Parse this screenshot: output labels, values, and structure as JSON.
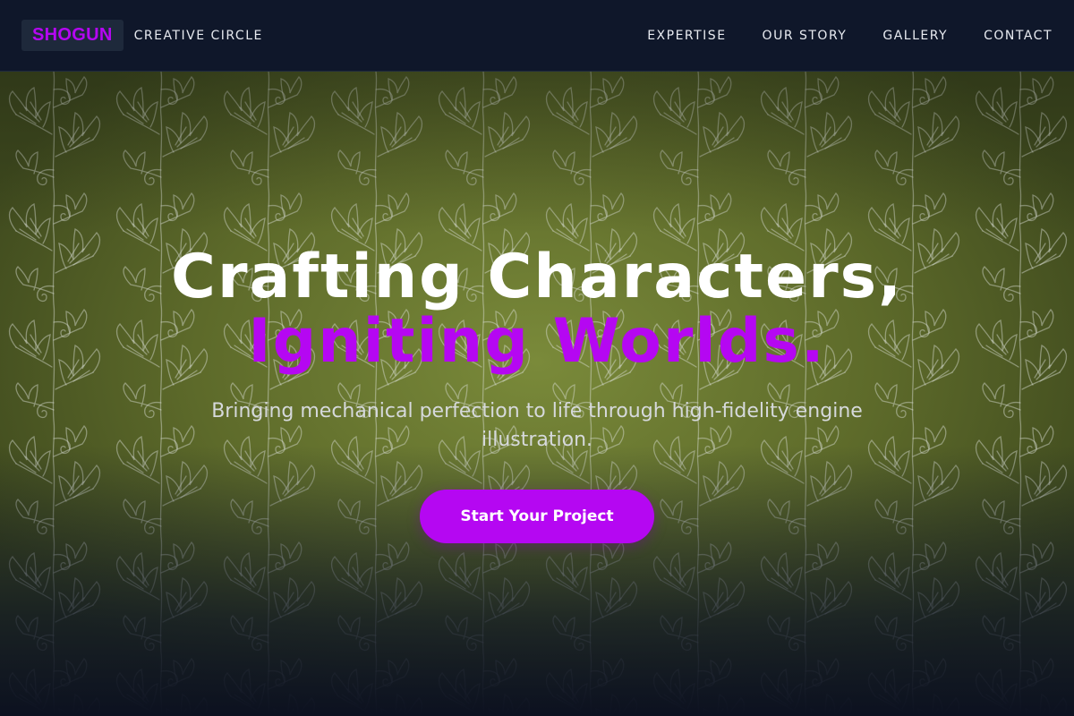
{
  "header": {
    "logo_text": "SHOGUN",
    "tagline": "CREATIVE CIRCLE",
    "nav": [
      {
        "label": "EXPERTISE"
      },
      {
        "label": "OUR STORY"
      },
      {
        "label": "GALLERY"
      },
      {
        "label": "CONTACT"
      }
    ]
  },
  "hero": {
    "headline_line1": "Crafting Characters,",
    "headline_line2": "Igniting Worlds.",
    "subtitle": "Bringing mechanical perfection to life through high-fidelity engine illustration.",
    "cta_label": "Start Your Project",
    "background_image": "olive-green-ginkgo-leaf-pattern"
  },
  "colors": {
    "accent": "#b507f2",
    "nav_background": "#0f172a",
    "logo_box": "#1e293b",
    "hero_green": "#6b7a30"
  }
}
